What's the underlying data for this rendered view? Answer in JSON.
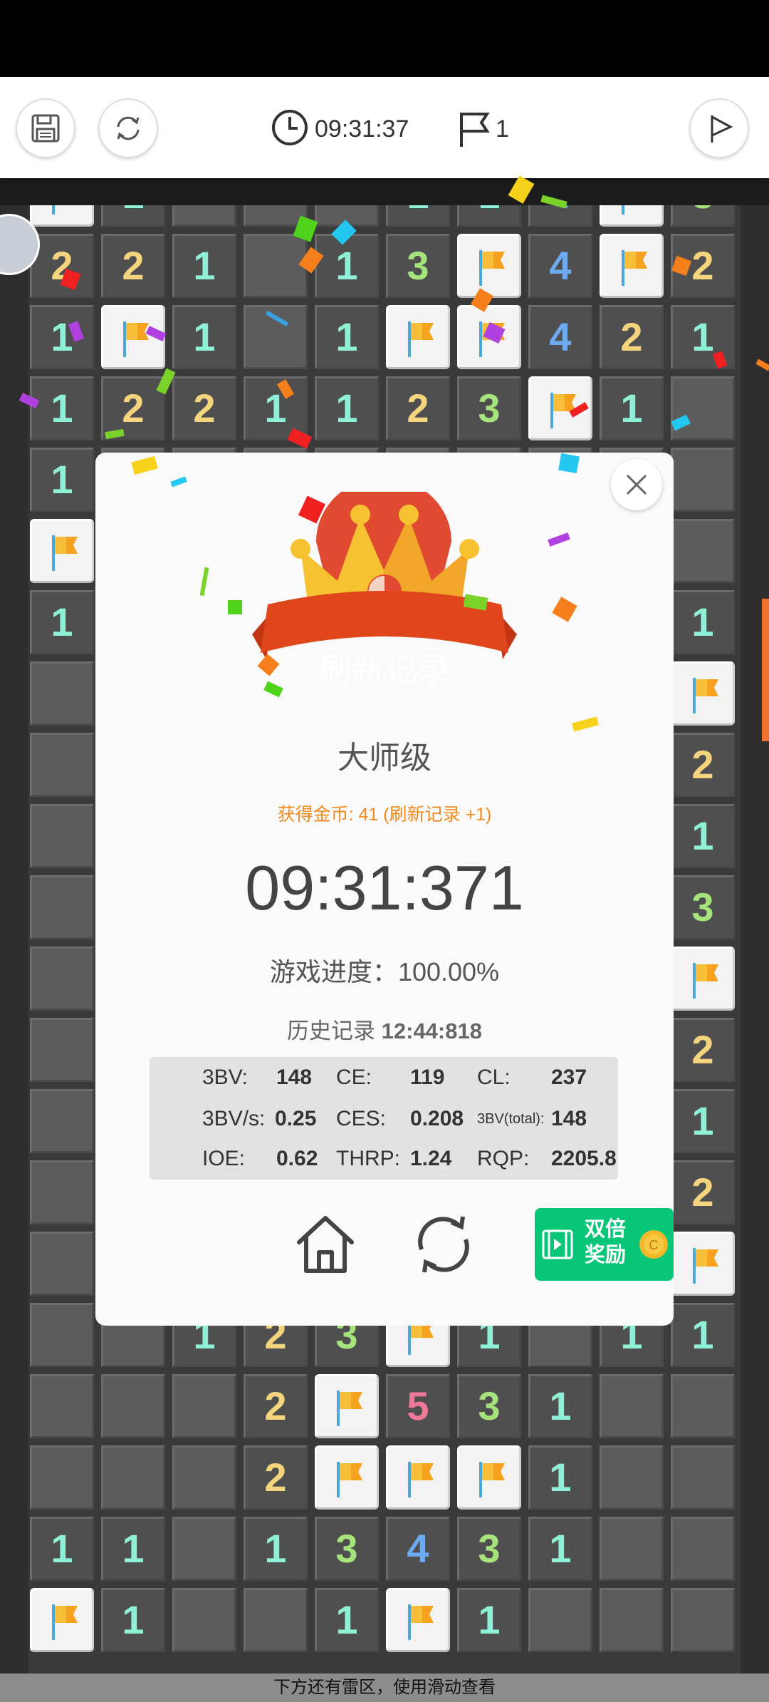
{
  "toolbar": {
    "timer": "09:31:37",
    "flags": "1",
    "buttons": [
      "save-icon",
      "refresh-icon",
      "play-flag-icon"
    ]
  },
  "board": {
    "rows": [
      [
        "F",
        "1",
        "",
        "",
        "",
        "1",
        "1",
        "4",
        "F",
        "3"
      ],
      [
        "2",
        "2",
        "1",
        "",
        "1",
        "3",
        "F",
        "4",
        "F",
        "2"
      ],
      [
        "1",
        "F",
        "1",
        "",
        "1",
        "F",
        "F",
        "4",
        "2",
        "1"
      ],
      [
        "1",
        "2",
        "2",
        "1",
        "1",
        "2",
        "3",
        "F",
        "1",
        ""
      ],
      [
        "1",
        "",
        "",
        "",
        "",
        "",
        "",
        "",
        "",
        ""
      ],
      [
        "F",
        "",
        "",
        "",
        "",
        "",
        "",
        "",
        "",
        ""
      ],
      [
        "1",
        "",
        "",
        "",
        "",
        "",
        "",
        "",
        "",
        "1"
      ],
      [
        "",
        "",
        "",
        "",
        "",
        "",
        "",
        "",
        "",
        "F"
      ],
      [
        "",
        "",
        "",
        "",
        "",
        "",
        "",
        "",
        "",
        "2"
      ],
      [
        "",
        "",
        "",
        "",
        "",
        "",
        "",
        "",
        "",
        "1"
      ],
      [
        "",
        "",
        "",
        "",
        "",
        "",
        "",
        "",
        "",
        "3"
      ],
      [
        "",
        "",
        "",
        "",
        "",
        "",
        "",
        "",
        "",
        "F"
      ],
      [
        "",
        "",
        "",
        "",
        "",
        "",
        "",
        "",
        "",
        "2"
      ],
      [
        "",
        "",
        "",
        "",
        "",
        "",
        "",
        "",
        "",
        "1"
      ],
      [
        "",
        "",
        "",
        "",
        "",
        "",
        "",
        "",
        "",
        "2"
      ],
      [
        "",
        "",
        "",
        "",
        "",
        "",
        "",
        "",
        "",
        "F"
      ],
      [
        "",
        "",
        "1",
        "2",
        "3",
        "F",
        "1",
        "",
        "1",
        "1"
      ],
      [
        "",
        "",
        "",
        "2",
        "F",
        "5",
        "3",
        "1",
        "",
        ""
      ],
      [
        "",
        "",
        "",
        "2",
        "F",
        "F",
        "F",
        "1",
        "",
        ""
      ],
      [
        "1",
        "1",
        "",
        "1",
        "3",
        "4",
        "3",
        "1",
        "",
        ""
      ],
      [
        "F",
        "1",
        "",
        "",
        "1",
        "F",
        "1",
        "",
        "",
        ""
      ]
    ],
    "scroll_hint": "下方还有雷区，使用滑动查看"
  },
  "modal": {
    "banner": "刷新记录",
    "level": "大师级",
    "coins": "获得金币: 41 (刷新记录 +1)",
    "time": "09:31:371",
    "progress_label": "游戏进度：",
    "progress_value": "100.00%",
    "history_label": "历史记录",
    "history_value": "12:44:818",
    "stats": {
      "bv_label": "3BV:",
      "bv": "148",
      "ce_label": "CE:",
      "ce": "119",
      "cl_label": "CL:",
      "cl": "237",
      "bvs_label": "3BV/s:",
      "bvs": "0.25",
      "ces_label": "CES:",
      "ces": "0.208",
      "bvtotal_label": "3BV(total):",
      "bvtotal": "148",
      "ioe_label": "IOE:",
      "ioe": "0.62",
      "thrp_label": "THRP:",
      "thrp": "1.24",
      "rqp_label": "RQP:",
      "rqp": "2205.8"
    },
    "double_reward": "双倍奖励",
    "coin_symbol": "C"
  },
  "colors": {
    "accent": "#08c678",
    "banner": "#e0461c",
    "coins": "#f08a1e"
  }
}
